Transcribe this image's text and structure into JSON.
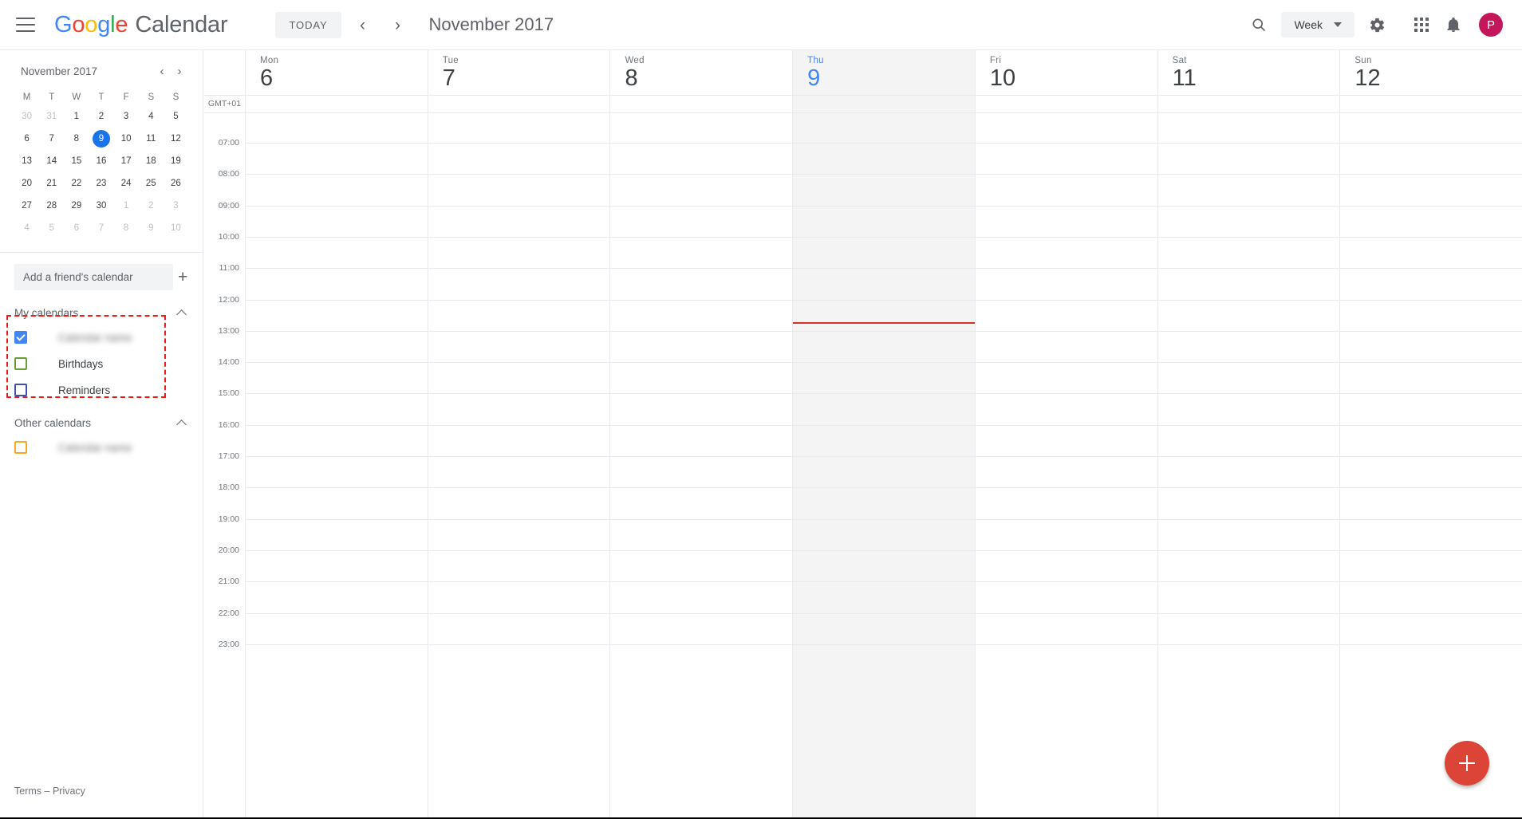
{
  "app": {
    "brand_google": "Google",
    "brand_word": "Calendar",
    "menu_icon": "hamburger-icon"
  },
  "toolbar": {
    "today_label": "TODAY",
    "prev_label": "‹",
    "next_label": "›",
    "month_title": "November 2017",
    "search_icon": "search-icon",
    "view_label": "Week",
    "settings_icon": "gear-icon",
    "apps_icon": "apps-grid-icon",
    "notifications_icon": "bell-icon",
    "avatar_initial": "P",
    "avatar_color": "#C2185B"
  },
  "mini_calendar": {
    "title": "November 2017",
    "prev_label": "‹",
    "next_label": "›",
    "dow": [
      "M",
      "T",
      "W",
      "T",
      "F",
      "S",
      "S"
    ],
    "weeks": [
      [
        {
          "d": "30",
          "muted": true
        },
        {
          "d": "31",
          "muted": true
        },
        {
          "d": "1"
        },
        {
          "d": "2"
        },
        {
          "d": "3"
        },
        {
          "d": "4"
        },
        {
          "d": "5"
        }
      ],
      [
        {
          "d": "6"
        },
        {
          "d": "7"
        },
        {
          "d": "8"
        },
        {
          "d": "9",
          "selected": true
        },
        {
          "d": "10"
        },
        {
          "d": "11"
        },
        {
          "d": "12"
        }
      ],
      [
        {
          "d": "13"
        },
        {
          "d": "14"
        },
        {
          "d": "15"
        },
        {
          "d": "16"
        },
        {
          "d": "17"
        },
        {
          "d": "18"
        },
        {
          "d": "19"
        }
      ],
      [
        {
          "d": "20"
        },
        {
          "d": "21"
        },
        {
          "d": "22"
        },
        {
          "d": "23"
        },
        {
          "d": "24"
        },
        {
          "d": "25"
        },
        {
          "d": "26"
        }
      ],
      [
        {
          "d": "27"
        },
        {
          "d": "28"
        },
        {
          "d": "29"
        },
        {
          "d": "30"
        },
        {
          "d": "1",
          "muted": true
        },
        {
          "d": "2",
          "muted": true
        },
        {
          "d": "3",
          "muted": true
        }
      ],
      [
        {
          "d": "4",
          "muted": true
        },
        {
          "d": "5",
          "muted": true
        },
        {
          "d": "6",
          "muted": true
        },
        {
          "d": "7",
          "muted": true
        },
        {
          "d": "8",
          "muted": true
        },
        {
          "d": "9",
          "muted": true
        },
        {
          "d": "10",
          "muted": true
        }
      ]
    ],
    "selected_color": "#1a73e8"
  },
  "add_friend": {
    "placeholder": "Add a friend's calendar",
    "value": "",
    "add_label": "+"
  },
  "my_calendars": {
    "title": "My calendars",
    "collapse_icon": "chevron-up-icon",
    "items": [
      {
        "label": "",
        "blurred": true,
        "checked": true,
        "color": "#4285F4"
      },
      {
        "label": "Birthdays",
        "blurred": false,
        "checked": false,
        "color": "#689F38"
      },
      {
        "label": "Reminders",
        "blurred": false,
        "checked": false,
        "color": "#3F51B5"
      }
    ]
  },
  "other_calendars": {
    "title": "Other calendars",
    "collapse_icon": "chevron-up-icon",
    "items": [
      {
        "label": "",
        "blurred": true,
        "checked": false,
        "color": "#F9A825"
      }
    ]
  },
  "footer": {
    "terms": "Terms",
    "separator": "–",
    "privacy": "Privacy"
  },
  "week_grid": {
    "timezone_label": "GMT+01",
    "days": [
      {
        "dow": "Mon",
        "dom": "6",
        "today": false
      },
      {
        "dow": "Tue",
        "dom": "7",
        "today": false
      },
      {
        "dow": "Wed",
        "dom": "8",
        "today": false
      },
      {
        "dow": "Thu",
        "dom": "9",
        "today": true
      },
      {
        "dow": "Fri",
        "dom": "10",
        "today": false
      },
      {
        "dow": "Sat",
        "dom": "11",
        "today": false
      },
      {
        "dow": "Sun",
        "dom": "12",
        "today": false
      }
    ],
    "hours": [
      "07:00",
      "08:00",
      "09:00",
      "10:00",
      "11:00",
      "12:00",
      "13:00",
      "14:00",
      "15:00",
      "16:00",
      "17:00",
      "18:00",
      "19:00",
      "20:00",
      "21:00",
      "22:00",
      "23:00"
    ],
    "now_indicator": {
      "color": "#d93025",
      "day_index": 3,
      "position_ratio": 0.2958
    },
    "events": []
  },
  "create_button": {
    "icon": "plus-icon",
    "color": "#db4437"
  },
  "annotation": {
    "style": "red-dashed-rectangle",
    "color": "#ee1b1b",
    "target": "my-calendars-section"
  }
}
